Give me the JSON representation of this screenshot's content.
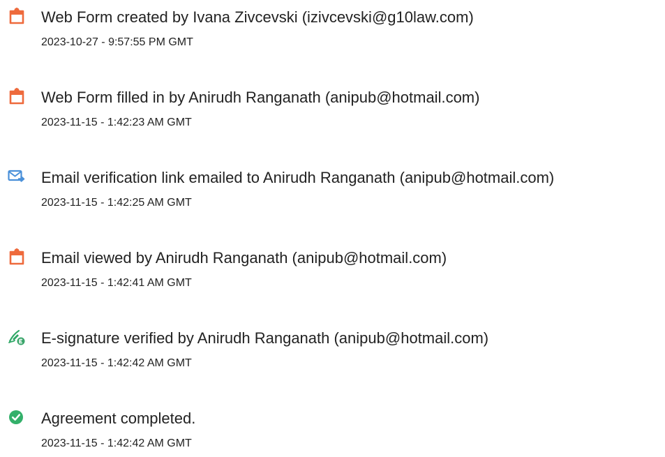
{
  "events": [
    {
      "icon": "document-icon",
      "title": "Web Form created by Ivana Zivcevski (izivcevski@g10law.com)",
      "timestamp": "2023-10-27 - 9:57:55 PM GMT"
    },
    {
      "icon": "document-icon",
      "title": "Web Form filled in by Anirudh Ranganath (anipub@hotmail.com)",
      "timestamp": "2023-11-15 - 1:42:23 AM GMT"
    },
    {
      "icon": "email-send-icon",
      "title": "Email verification link emailed to Anirudh Ranganath (anipub@hotmail.com)",
      "timestamp": "2023-11-15 - 1:42:25 AM GMT"
    },
    {
      "icon": "document-icon",
      "title": "Email viewed by Anirudh Ranganath (anipub@hotmail.com)",
      "timestamp": "2023-11-15 - 1:42:41 AM GMT"
    },
    {
      "icon": "esignature-icon",
      "title": "E-signature verified by Anirudh Ranganath (anipub@hotmail.com)",
      "timestamp": "2023-11-15 - 1:42:42 AM GMT"
    },
    {
      "icon": "check-circle-icon",
      "title": "Agreement completed.",
      "timestamp": "2023-11-15 - 1:42:42 AM GMT"
    }
  ],
  "colors": {
    "document_icon": "#ee6a3c",
    "email_icon": "#4a90d9",
    "signature_pen": "#2fa866",
    "signature_badge": "#3aa56a",
    "check_circle": "#33b06a",
    "text": "#222222"
  }
}
